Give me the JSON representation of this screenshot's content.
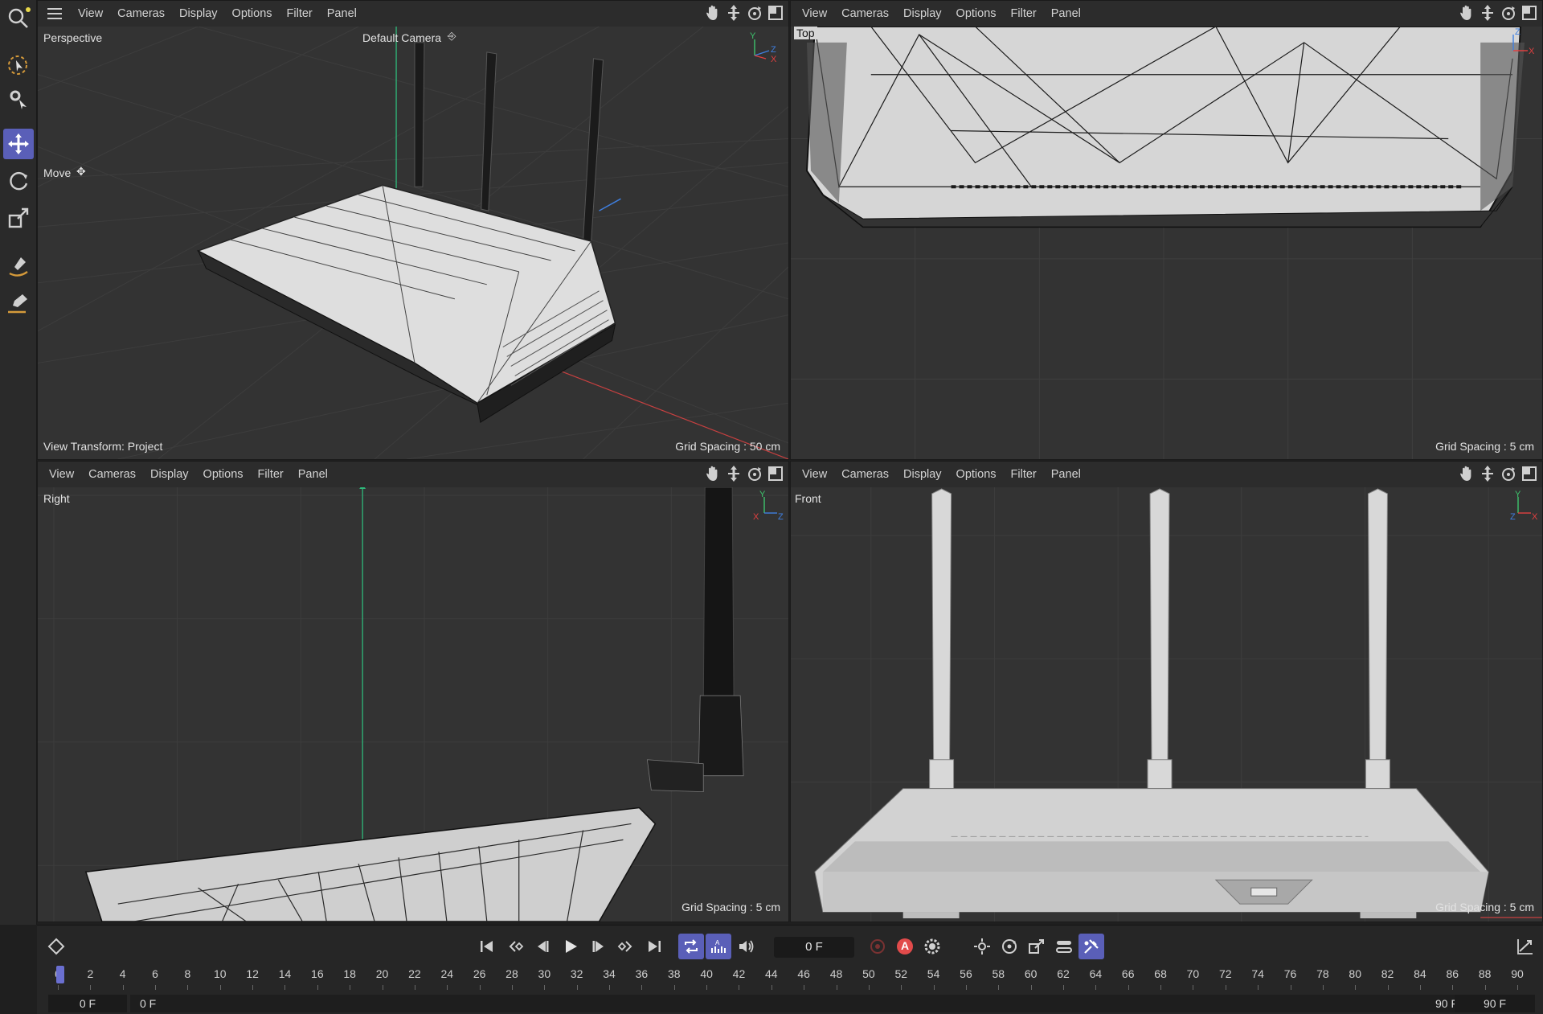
{
  "viewport_menu": [
    "View",
    "Cameras",
    "Display",
    "Options",
    "Filter",
    "Panel"
  ],
  "viewports": {
    "perspective": {
      "name": "Perspective",
      "camera": "Default Camera",
      "tool": "Move",
      "view_transform": "View Transform: Project",
      "grid": "Grid Spacing : 50 cm"
    },
    "top": {
      "name": "Top",
      "grid": "Grid Spacing : 5 cm"
    },
    "right": {
      "name": "Right",
      "grid": "Grid Spacing : 5 cm"
    },
    "front": {
      "name": "Front",
      "grid": "Grid Spacing : 5 cm"
    }
  },
  "axes": {
    "perspective": [
      "Y",
      "Z",
      "X"
    ],
    "top": [
      "Z",
      "X"
    ],
    "right": [
      "Y",
      "X",
      "Z"
    ],
    "front": [
      "Y",
      "Z",
      "X"
    ]
  },
  "colors": {
    "accent": "#5a5fb8",
    "axis_x": "#e04040",
    "axis_y": "#3ec46d",
    "axis_z": "#3f7fe0",
    "record": "#e24b4b"
  },
  "tools": [
    "search-icon",
    "live-selection-icon",
    "settings-select-icon",
    "move-icon",
    "rotate-icon",
    "scale-icon",
    "paint-icon",
    "pen-icon"
  ],
  "timeline": {
    "current_frame": "0 F",
    "ticks": [
      "0",
      "2",
      "4",
      "6",
      "8",
      "10",
      "12",
      "14",
      "16",
      "18",
      "20",
      "22",
      "24",
      "26",
      "28",
      "30",
      "32",
      "34",
      "36",
      "38",
      "40",
      "42",
      "44",
      "46",
      "48",
      "50",
      "52",
      "54",
      "56",
      "58",
      "60",
      "62",
      "64",
      "66",
      "68",
      "70",
      "72",
      "74",
      "76",
      "78",
      "80",
      "82",
      "84",
      "86",
      "88",
      "90"
    ],
    "range_start": "0 F",
    "range_start_2": "0 F",
    "range_end": "90 F",
    "range_end_2": "90 F",
    "record_label": "A"
  }
}
